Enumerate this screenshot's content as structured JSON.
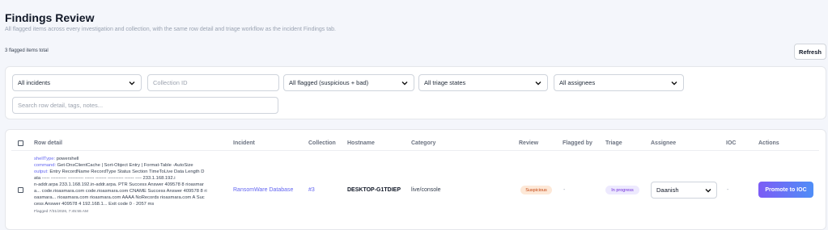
{
  "header": {
    "title": "Findings Review",
    "subtitle": "All flagged items across every investigation and collection, with the same row detail and triage workflow as the incident Findings tab."
  },
  "summary": {
    "count_text": "3 flagged items total"
  },
  "toolbar": {
    "refresh_label": "Refresh"
  },
  "filters": {
    "incident_value": "All incidents",
    "collection_placeholder": "Collection ID",
    "review_value": "All flagged (suspicious + bad)",
    "triage_value": "All triage states",
    "assignee_value": "All assignees",
    "search_placeholder": "Search row detail, tags, notes..."
  },
  "table": {
    "columns": {
      "row_detail": "Row detail",
      "incident": "Incident",
      "collection": "Collection",
      "hostname": "Hostname",
      "category": "Category",
      "review": "Review",
      "flagged_by": "Flagged by",
      "triage": "Triage",
      "assignee": "Assignee",
      "ioc": "IOC",
      "actions": "Actions"
    },
    "rows": [
      {
        "shelltype_key": "shellType:",
        "shelltype_val": " powershell",
        "command_key": "command:",
        "command_val": " Get-DnsClientCache | Sort-Object Entry | Format-Table -AutoSize",
        "output_key": "output:",
        "output_l1": " Entry RecordName RecordType Status Section TimeToLive Data Length D",
        "output_l2": "ata ----- ---------- ---------- ------ ------- ---------- ------ ---- 233.1.168.192.i",
        "output_l3": "n-addr.arpa 233.1.168.192.in-addr.arpa. PTR Success Answer 409578 8 rioasmar",
        "output_l4": "a... code.rioasmara.com code.rioasmara.com CNAME Success Answer 409578 8 ri",
        "output_l5": "oasmara... rioasmara.com rioasmara.com AAAA NoRecords rioasmara.com A Suc",
        "output_l6": "cess Answer 409578 4 192.168.1... Exit code 0 · 2057 ms",
        "flagged_at": "Flagged 7/31/2026, 7:45:55 AM",
        "incident": "RansomWare Database",
        "collection": "#3",
        "hostname": "DESKTOP-G1TDIEP",
        "category": "live/console",
        "review": "Suspicious",
        "flagged_by": "-",
        "triage": "In progress",
        "assignee": "Daanish",
        "ioc": "-",
        "action": "Promote to IOC"
      }
    ]
  },
  "colors": {
    "accent": "#6366f1",
    "suspicious_bg": "#fde8d7",
    "suspicious_fg": "#c2410c",
    "in_progress_bg": "#ede9fe",
    "in_progress_fg": "#6d28d9"
  },
  "icons": {
    "dropdown": "chevron-down-icon"
  }
}
